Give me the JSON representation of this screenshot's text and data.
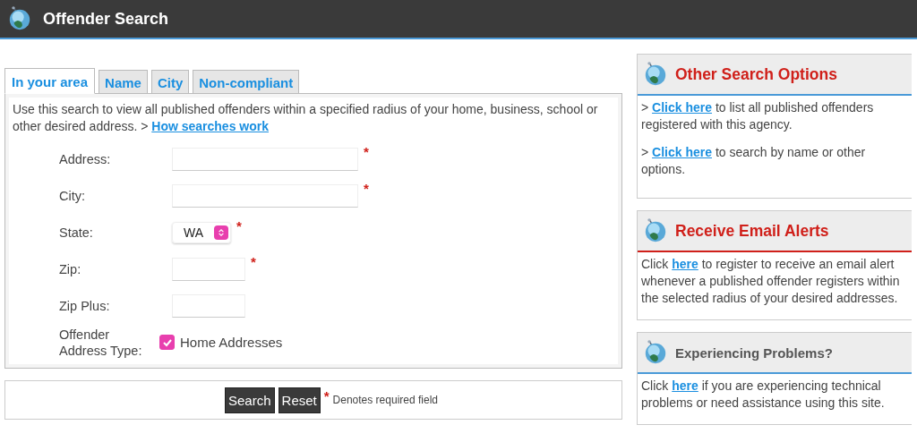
{
  "header": {
    "title": "Offender Search"
  },
  "tabs": [
    {
      "label": "In your area",
      "selected": true
    },
    {
      "label": "Name",
      "selected": false
    },
    {
      "label": "City",
      "selected": false
    },
    {
      "label": "Non-compliant",
      "selected": false
    }
  ],
  "intro": {
    "text": "Use this search to view all published offenders within a specified radius of your home, business, school or other desired address. > ",
    "link": "How searches work"
  },
  "fields": [
    {
      "kind": "wide",
      "label": "Address:",
      "required": true
    },
    {
      "kind": "wide",
      "label": "City:",
      "required": true
    },
    {
      "kind": "select",
      "label": "State:",
      "value": "WA",
      "required": true
    },
    {
      "kind": "short",
      "label": "Zip:",
      "required": true
    },
    {
      "kind": "short",
      "label": "Zip Plus:",
      "required": false
    },
    {
      "kind": "checkbox",
      "label": "Offender Address Type:",
      "option": "Home Addresses",
      "checked": true,
      "required": false
    }
  ],
  "actions": {
    "buttons": [
      "Search",
      "Reset"
    ],
    "required_mark": "*",
    "note": "Denotes required field"
  },
  "sidebar": [
    {
      "title": "Other Search Options",
      "color": "#d0201a",
      "kind": "plain",
      "paragraphs": [
        {
          "prefix": "> ",
          "link": "Click here",
          "suffix": " to list all published offenders registered with this agency."
        },
        {
          "prefix": "> ",
          "link": "Click here",
          "suffix": " to search by name or other options."
        }
      ]
    },
    {
      "title": "Receive Email Alerts",
      "color": "#d0201a",
      "kind": "alert",
      "paragraphs": [
        {
          "prefix": "Click ",
          "link": "here",
          "suffix": " to register to receive an email alert whenever a published offender registers within the selected radius of your desired addresses."
        }
      ]
    },
    {
      "title": "Experiencing Problems?",
      "color": "#555555",
      "kind": "plain",
      "paragraphs": [
        {
          "prefix": "Click ",
          "link": "here",
          "suffix": " if you are experiencing technical problems or need assistance using this site."
        }
      ]
    }
  ]
}
